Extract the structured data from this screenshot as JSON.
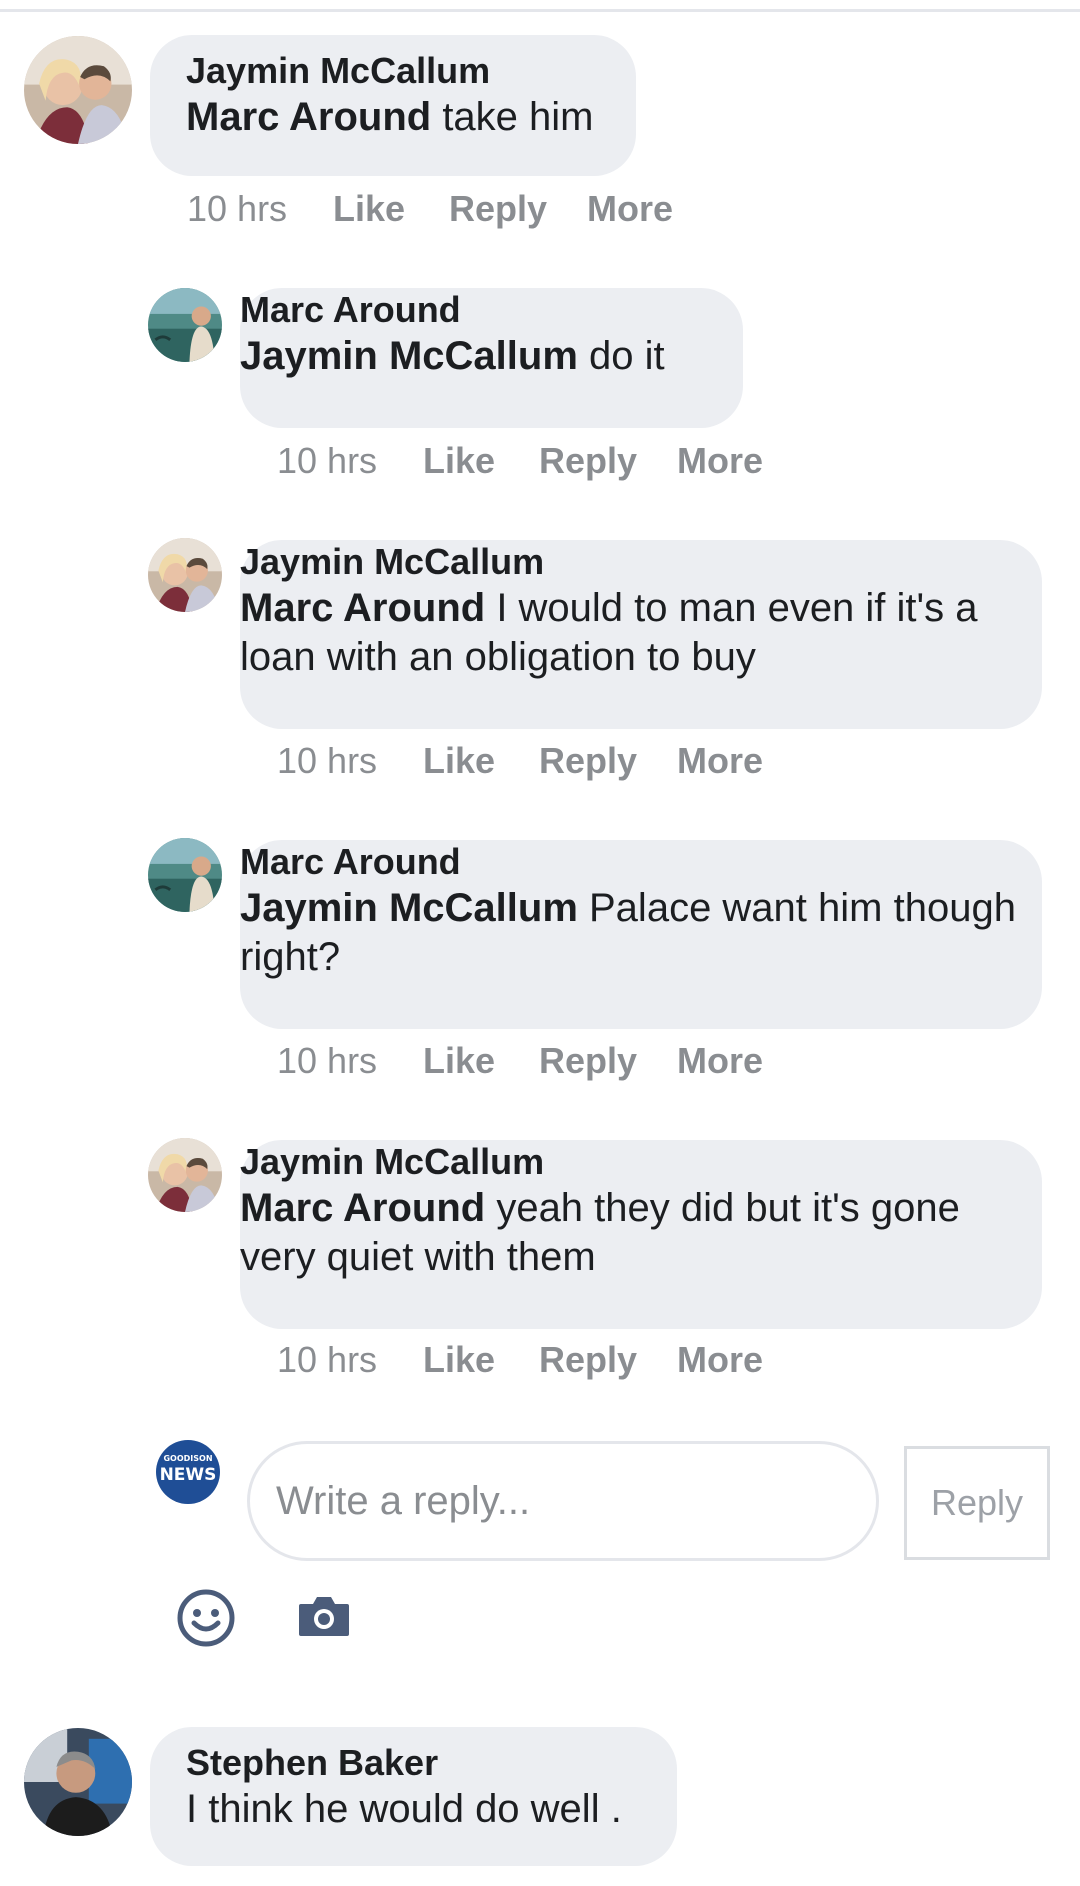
{
  "comments": [
    {
      "author": "Jaymin McCallum",
      "mention": "Marc Around",
      "text": " take him",
      "time": "10 hrs",
      "actions": [
        "Like",
        "Reply",
        "More"
      ],
      "avatar": "couple-photo-avatar"
    }
  ],
  "replies": [
    {
      "author": "Marc Around",
      "mention": "Jaymin McCallum",
      "text": " do it",
      "time": "10 hrs",
      "actions": [
        "Like",
        "Reply",
        "More"
      ],
      "avatar": "beach-photo-avatar"
    },
    {
      "author": "Jaymin McCallum",
      "mention": "Marc Around",
      "text": " I would to man even if it's a loan with an obligation to buy",
      "time": "10 hrs",
      "actions": [
        "Like",
        "Reply",
        "More"
      ],
      "avatar": "couple-photo-avatar"
    },
    {
      "author": "Marc Around",
      "mention": "Jaymin McCallum",
      "text": " Palace want him though right?",
      "time": "10 hrs",
      "actions": [
        "Like",
        "Reply",
        "More"
      ],
      "avatar": "beach-photo-avatar"
    },
    {
      "author": "Jaymin McCallum",
      "mention": "Marc Around",
      "text": " yeah they did but it's gone very quiet with them",
      "time": "10 hrs",
      "actions": [
        "Like",
        "Reply",
        "More"
      ],
      "avatar": "couple-photo-avatar"
    }
  ],
  "composer": {
    "page_avatar_line1": "GOODISON",
    "page_avatar_line2": "NEWS",
    "placeholder": "Write a reply...",
    "button": "Reply",
    "icons": [
      "emoji-icon",
      "camera-icon"
    ]
  },
  "last_comment": {
    "author": "Stephen Baker",
    "text": "I think he would do well .",
    "avatar": "man-photo-avatar"
  },
  "colors": {
    "bubble": "#eceef2",
    "meta_text": "#8a8d91",
    "primary_text": "#1c1e21",
    "icon": "#4b5c7a",
    "news_badge": "#1f4e96"
  }
}
